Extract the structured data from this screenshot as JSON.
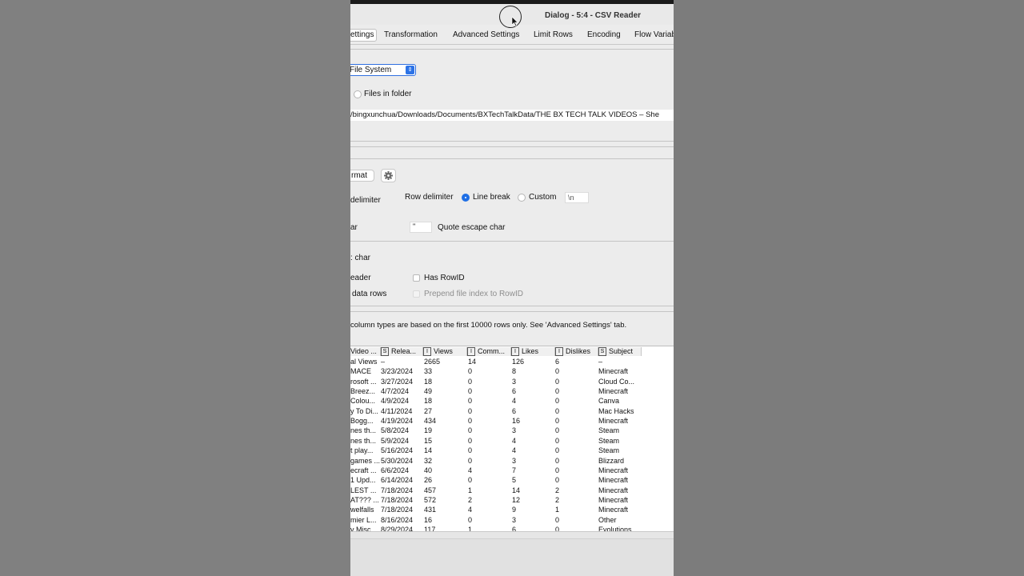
{
  "window": {
    "title": "Dialog - 5:4 - CSV Reader"
  },
  "tabs": [
    {
      "label": "ettings"
    },
    {
      "label": "Transformation"
    },
    {
      "label": "Advanced Settings"
    },
    {
      "label": "Limit Rows"
    },
    {
      "label": "Encoding"
    },
    {
      "label": "Flow Variab"
    }
  ],
  "source": {
    "mode_value": "File System",
    "files_in_folder_label": "Files in folder",
    "path": "/bingxunchua/Downloads/Documents/BXTechTalkData/THE BX TECH TALK VIDEOS – She"
  },
  "format": {
    "autodetect_label": "rmat",
    "col_delimiter_label": "delimiter",
    "row_delimiter_label": "Row delimiter",
    "line_break_label": "Line break",
    "custom_label": "Custom",
    "custom_value": "\\n",
    "quote_char_label": "ar",
    "quote_char_value": "\"",
    "quote_escape_label": "Quote escape char",
    "comment_char_label": ": char",
    "col_header_label": "eader",
    "has_rowid_label": "Has RowID",
    "skip_rows_label": "data rows",
    "prepend_label": "Prepend file index to RowID"
  },
  "preview": {
    "note": "column types are based on the first 10000 rows only. See 'Advanced Settings' tab.",
    "columns": [
      {
        "badge": "",
        "name": "Video ..."
      },
      {
        "badge": "S",
        "name": "Relea..."
      },
      {
        "badge": "I",
        "name": "Views"
      },
      {
        "badge": "I",
        "name": "Comm..."
      },
      {
        "badge": "I",
        "name": "Likes"
      },
      {
        "badge": "I",
        "name": "Dislikes"
      },
      {
        "badge": "S",
        "name": "Subject"
      }
    ],
    "rows": [
      [
        "al Views",
        "–",
        "2665",
        "14",
        "126",
        "6",
        "–"
      ],
      [
        "MACE",
        "3/23/2024",
        "33",
        "0",
        "8",
        "0",
        "Minecraft"
      ],
      [
        "rosoft ...",
        "3/27/2024",
        "18",
        "0",
        "3",
        "0",
        "Cloud Co..."
      ],
      [
        "Breez...",
        "4/7/2024",
        "49",
        "0",
        "6",
        "0",
        "Minecraft"
      ],
      [
        "Colou...",
        "4/9/2024",
        "18",
        "0",
        "4",
        "0",
        "Canva"
      ],
      [
        "y To Di...",
        "4/11/2024",
        "27",
        "0",
        "6",
        "0",
        "Mac Hacks"
      ],
      [
        "Bogg...",
        "4/19/2024",
        "434",
        "0",
        "16",
        "0",
        "Minecraft"
      ],
      [
        "nes th...",
        "5/8/2024",
        "19",
        "0",
        "3",
        "0",
        "Steam"
      ],
      [
        "nes th...",
        "5/9/2024",
        "15",
        "0",
        "4",
        "0",
        "Steam"
      ],
      [
        "t play...",
        "5/16/2024",
        "14",
        "0",
        "4",
        "0",
        "Steam"
      ],
      [
        "games ...",
        "5/30/2024",
        "32",
        "0",
        "3",
        "0",
        "Blizzard"
      ],
      [
        "ecraft ...",
        "6/6/2024",
        "40",
        "4",
        "7",
        "0",
        "Minecraft"
      ],
      [
        "1 Upd...",
        "6/14/2024",
        "26",
        "0",
        "5",
        "0",
        "Minecraft"
      ],
      [
        "LEST ...",
        "7/18/2024",
        "457",
        "1",
        "14",
        "2",
        "Minecraft"
      ],
      [
        "AT??? ...",
        "7/18/2024",
        "572",
        "2",
        "12",
        "2",
        "Minecraft"
      ],
      [
        "welfalls",
        "7/18/2024",
        "431",
        "4",
        "9",
        "1",
        "Minecraft"
      ],
      [
        "mier L...",
        "8/16/2024",
        "16",
        "0",
        "3",
        "0",
        "Other"
      ],
      [
        "y Misc",
        "8/29/2024",
        "117",
        "1",
        "6",
        "0",
        "Evolutions"
      ]
    ]
  }
}
